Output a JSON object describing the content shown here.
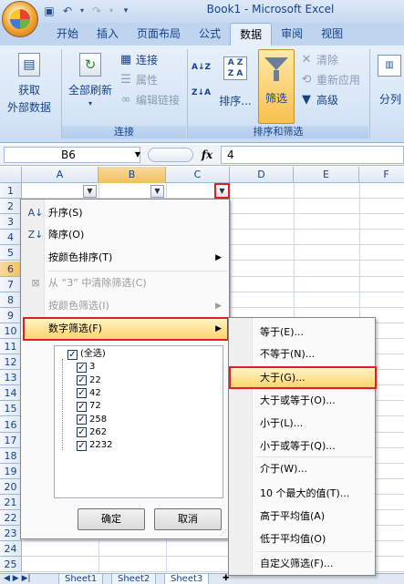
{
  "window": {
    "title": "Book1 - Microsoft Excel"
  },
  "ribbon": {
    "tabs": [
      "开始",
      "插入",
      "页面布局",
      "公式",
      "数据",
      "审阅",
      "视图"
    ],
    "active_tab": "数据",
    "groups": {
      "get_external": {
        "label_line1": "获取",
        "label_line2": "外部数据"
      },
      "connections": {
        "label": "连接",
        "refresh_all": "全部刷新",
        "connections_btn": "连接",
        "properties_btn": "属性",
        "edit_links_btn": "编辑链接"
      },
      "sort_filter": {
        "label": "排序和筛选",
        "sort_btn": "排序...",
        "filter_btn": "筛选",
        "clear_btn": "清除",
        "reapply_btn": "重新应用",
        "advanced_btn": "高级",
        "az": "A↓Z",
        "za": "Z↓A"
      },
      "data_tools": {
        "split_btn": "分列"
      }
    }
  },
  "formula_bar": {
    "name_box": "B6",
    "fx_label": "fx",
    "value": "4"
  },
  "grid": {
    "columns": [
      "A",
      "B",
      "C",
      "D",
      "E",
      "F"
    ],
    "selected_column": "B",
    "rows": [
      "1",
      "2",
      "3",
      "4",
      "5",
      "6",
      "7",
      "8",
      "9",
      "10",
      "11",
      "12",
      "13",
      "14",
      "15",
      "16",
      "17",
      "18",
      "19",
      "20",
      "21",
      "22",
      "23",
      "24",
      "25"
    ],
    "selected_row": "6"
  },
  "filter_menu": {
    "items": {
      "sort_asc": "升序(S)",
      "sort_desc": "降序(O)",
      "sort_by_color": "按颜色排序(T)",
      "clear_filter": "从 “3” 中清除筛选(C)",
      "filter_by_color": "按颜色筛选(I)",
      "number_filter": "数字筛选(F)"
    },
    "checklist": [
      "(全选)",
      "3",
      "22",
      "42",
      "72",
      "258",
      "262",
      "2232"
    ],
    "ok_button": "确定",
    "cancel_button": "取消"
  },
  "number_filter_submenu": [
    "等于(E)...",
    "不等于(N)...",
    "大于(G)...",
    "大于或等于(O)...",
    "小于(L)...",
    "小于或等于(Q)...",
    "介于(W)...",
    "10 个最大的值(T)...",
    "高于平均值(A)",
    "低于平均值(O)",
    "自定义筛选(F)..."
  ],
  "sheets": [
    "Sheet1",
    "Sheet2",
    "Sheet3"
  ],
  "active_sheet": "Sheet3"
}
